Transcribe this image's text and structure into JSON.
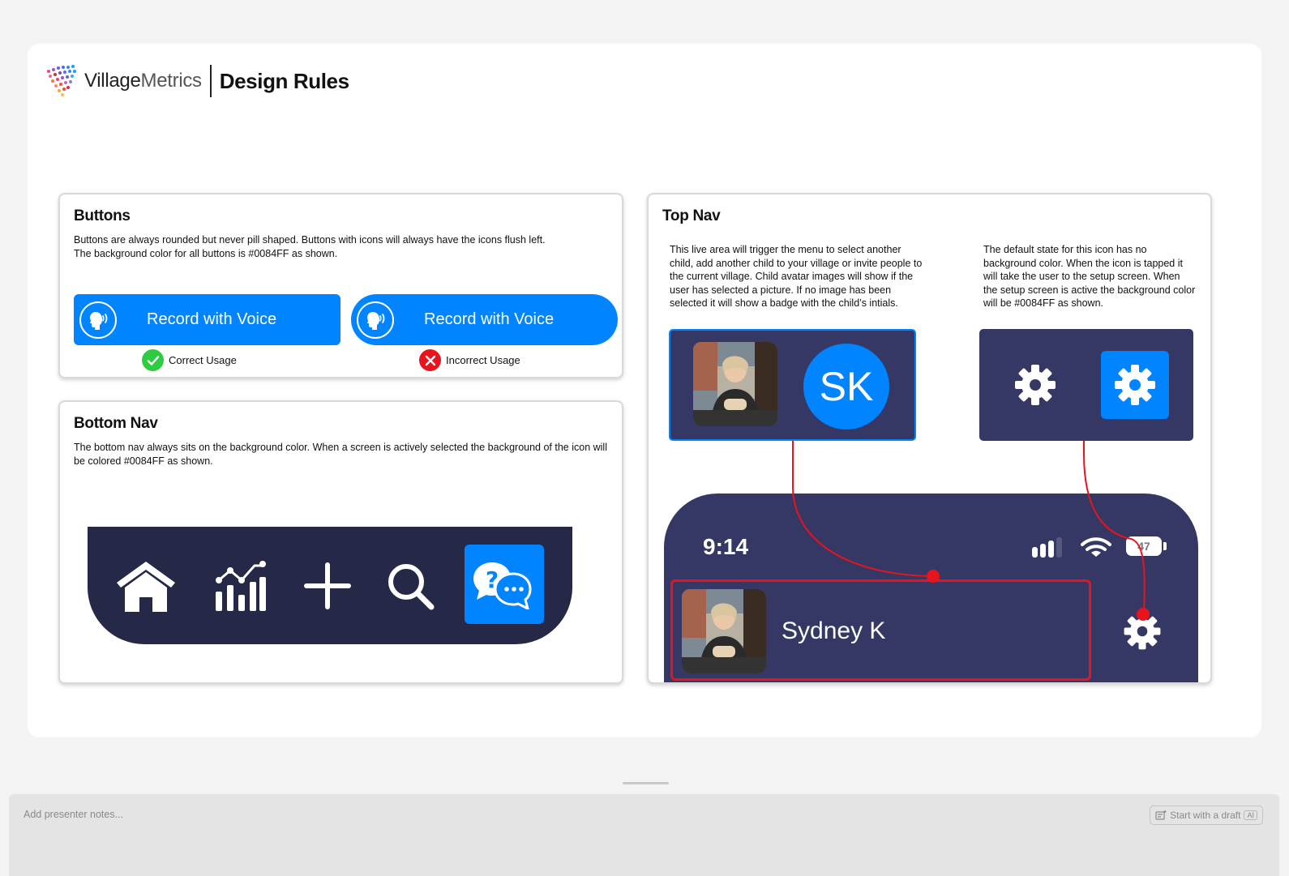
{
  "header": {
    "brand_part1": "Village",
    "brand_part2": "Metrics",
    "title": "Design Rules"
  },
  "buttons_card": {
    "title": "Buttons",
    "description_line1": "Buttons are always rounded but never pill shaped.  Buttons with icons will always have the icons flush left.",
    "description_line2": "The background color for all buttons is #0084FF as shown.",
    "button_label": "Record with Voice",
    "correct_label": "Correct Usage",
    "incorrect_label": "Incorrect Usage",
    "accent_color": "#0084FF",
    "correct_color": "#2ecc40",
    "incorrect_color": "#e8131d"
  },
  "bottom_nav_card": {
    "title": "Bottom Nav",
    "description": "The bottom nav always sits on the background color. When a screen is actively selected the background of the icon will be colored #0084FF as shown.",
    "icons": [
      "home-icon",
      "analytics-icon",
      "add-icon",
      "search-icon",
      "chat-help-icon"
    ],
    "active_icon": "chat-help-icon",
    "nav_color": "#262848"
  },
  "top_nav_card": {
    "title": "Top Nav",
    "left_description": "This live area will trigger the menu to select another child, add another child to your village or invite people to the current village. Child avatar images will show if the user has selected a picture. If no image has been selected it will show a badge with the child’s intials.",
    "right_description": "The default state for this icon has no background color. When the icon is tapped it will take the user to the setup screen. When the setup screen is active the background color will be #0084FF as shown.",
    "initials_badge": "SK",
    "status_time": "9:14",
    "battery": "47",
    "child_name": "Sydney K",
    "panel_color": "#353865",
    "callout_color": "#e8131d"
  },
  "notes": {
    "placeholder": "Add presenter notes...",
    "draft_button": "Start with a draft",
    "ai_badge": "AI"
  }
}
